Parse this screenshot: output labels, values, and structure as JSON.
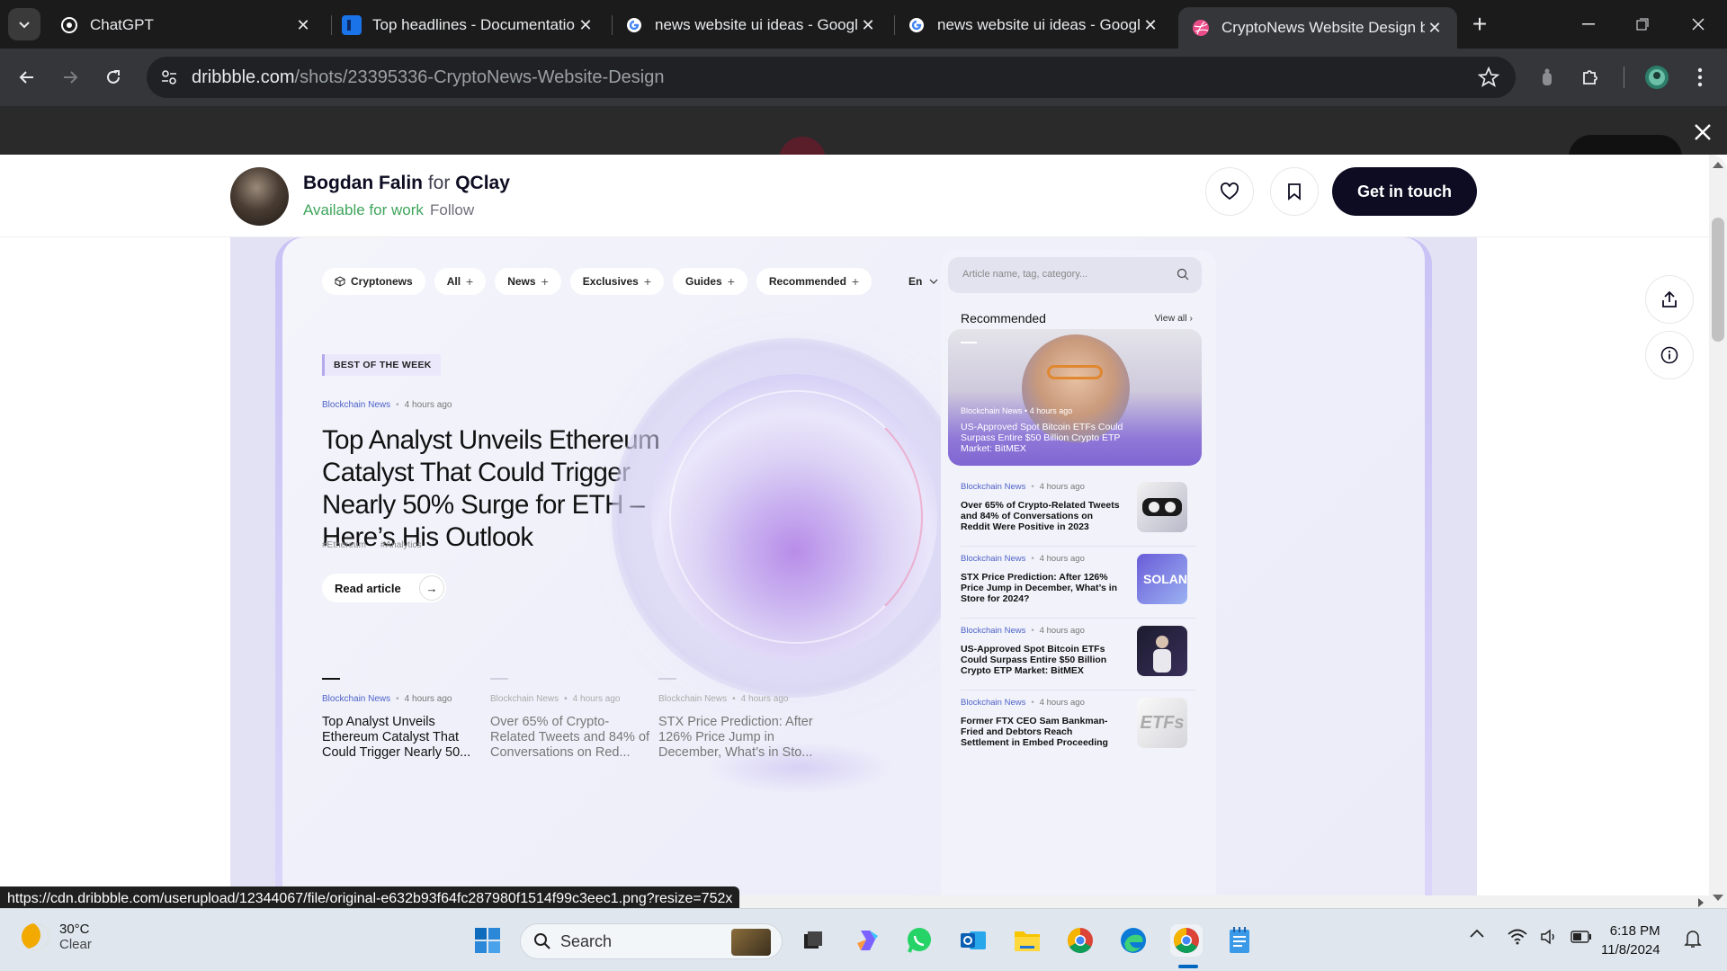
{
  "browser": {
    "tabs": [
      {
        "title": "ChatGPT",
        "favicon": "chatgpt-icon",
        "active": false
      },
      {
        "title": "Top headlines - Documentation",
        "favicon": "document-icon",
        "active": false
      },
      {
        "title": "news website ui ideas - Google",
        "favicon": "google-icon",
        "active": false
      },
      {
        "title": "news website ui ideas - Google",
        "favicon": "google-icon",
        "active": false
      },
      {
        "title": "CryptoNews Website Design b",
        "favicon": "dribbble-icon",
        "active": true
      }
    ],
    "url_host": "dribbble.com",
    "url_path": "/shots/23395336-CryptoNews-Website-Design"
  },
  "shot": {
    "author": "Bogdan Falin",
    "for_word": "for",
    "team": "QClay",
    "availability": "Available for work",
    "follow": "Follow",
    "cta": "Get in touch"
  },
  "design": {
    "nav": {
      "chips": [
        {
          "label": "Cryptonews",
          "icon": "cube-icon"
        },
        {
          "label": "All",
          "plus": "+"
        },
        {
          "label": "News",
          "plus": "+"
        },
        {
          "label": "Exclusives",
          "plus": "+"
        },
        {
          "label": "Guides",
          "plus": "+"
        },
        {
          "label": "Recommended",
          "plus": "+"
        }
      ],
      "lang": "En"
    },
    "hero": {
      "badge": "BEST OF THE WEEK",
      "category": "Blockchain News",
      "time": "4 hours ago",
      "title": "Top Analyst Unveils Ethereum Catalyst That Could Trigger Nearly 50% Surge for ETH – Here’s His Outlook",
      "tags": [
        "#Ethereum",
        "#Analytics"
      ],
      "read": "Read article",
      "arrow": "→"
    },
    "bottom_cards": [
      {
        "category": "Blockchain News",
        "time": "4 hours ago",
        "title": "Top Analyst Unveils Ethereum Catalyst That Could Trigger Nearly 50..."
      },
      {
        "category": "Blockchain News",
        "time": "4 hours ago",
        "title": "Over 65% of Crypto-Related Tweets and 84% of Conversations on Red..."
      },
      {
        "category": "Blockchain News",
        "time": "4 hours ago",
        "title": "STX Price Prediction: After 126% Price Jump in December, What’s in Sto..."
      }
    ],
    "sidebar": {
      "search_placeholder": "Article name, tag, category...",
      "recommended": "Recommended",
      "view_all": "View all",
      "featured": {
        "category": "Blockchain News",
        "time": "4 hours ago",
        "title": "US-Approved Spot Bitcoin ETFs Could Surpass Entire $50 Billion Crypto ETP Market: BitMEX"
      },
      "items": [
        {
          "category": "Blockchain News",
          "time": "4 hours ago",
          "title": "Over 65% of Crypto-Related Tweets and 84% of Conversations on Reddit Were Positive in 2023"
        },
        {
          "category": "Blockchain News",
          "time": "4 hours ago",
          "title": "STX Price Prediction: After 126% Price Jump in December, What’s in Store for 2024?",
          "thumb_text": "SOLAN"
        },
        {
          "category": "Blockchain News",
          "time": "4 hours ago",
          "title": "US-Approved Spot Bitcoin ETFs Could Surpass Entire $50 Billion Crypto ETP Market: BitMEX"
        },
        {
          "category": "Blockchain News",
          "time": "4 hours ago",
          "title": "Former FTX CEO Sam Bankman-Fried and Debtors Reach Settlement in Embed Proceeding",
          "thumb_text": "ETFs"
        }
      ]
    }
  },
  "status_url": "https://cdn.dribbble.com/userupload/12344067/file/original-e632b93f64fc287980f1514f99c3eec1.png?resize=752x",
  "taskbar": {
    "temp": "30°C",
    "condition": "Clear",
    "search": "Search",
    "time": "6:18 PM",
    "date": "11/8/2024"
  },
  "colors": {
    "accent": "#0d0c22",
    "available": "#3fa55c",
    "category": "#4d63c8",
    "frame": "#c9c2f5"
  }
}
